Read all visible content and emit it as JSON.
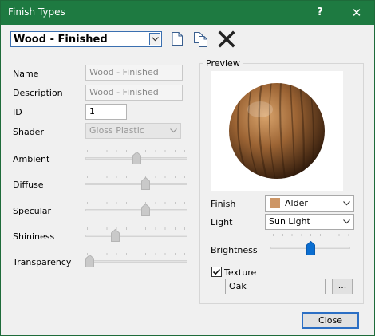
{
  "window": {
    "title": "Finish Types",
    "help_label": "?",
    "close_glyph": "✕"
  },
  "toolbar": {
    "finish_combo_value": "Wood - Finished",
    "new_icon": "new-document-icon",
    "copy_icon": "copy-document-icon",
    "delete_icon": "delete-x-icon"
  },
  "properties": {
    "name_label": "Name",
    "name_value": "Wood - Finished",
    "description_label": "Description",
    "description_value": "Wood - Finished",
    "id_label": "ID",
    "id_value": "1",
    "shader_label": "Shader",
    "shader_value": "Gloss Plastic"
  },
  "sliders": {
    "ambient": {
      "label": "Ambient",
      "value": 0.5
    },
    "diffuse": {
      "label": "Diffuse",
      "value": 0.6
    },
    "specular": {
      "label": "Specular",
      "value": 0.6
    },
    "shininess": {
      "label": "Shininess",
      "value": 0.27
    },
    "transparency": {
      "label": "Transparency",
      "value": 0.0
    }
  },
  "preview": {
    "group_title": "Preview",
    "finish_label": "Finish",
    "finish_value": "Alder",
    "finish_swatch_color": "#cd9666",
    "light_label": "Light",
    "light_value": "Sun Light",
    "brightness_label": "Brightness",
    "brightness_value": 0.5,
    "texture_label": "Texture",
    "texture_checked": true,
    "texture_value": "Oak",
    "browse_label": "..."
  },
  "footer": {
    "close_label": "Close"
  },
  "colors": {
    "titlebar": "#1e7a41",
    "accent": "#0a6ed1"
  }
}
